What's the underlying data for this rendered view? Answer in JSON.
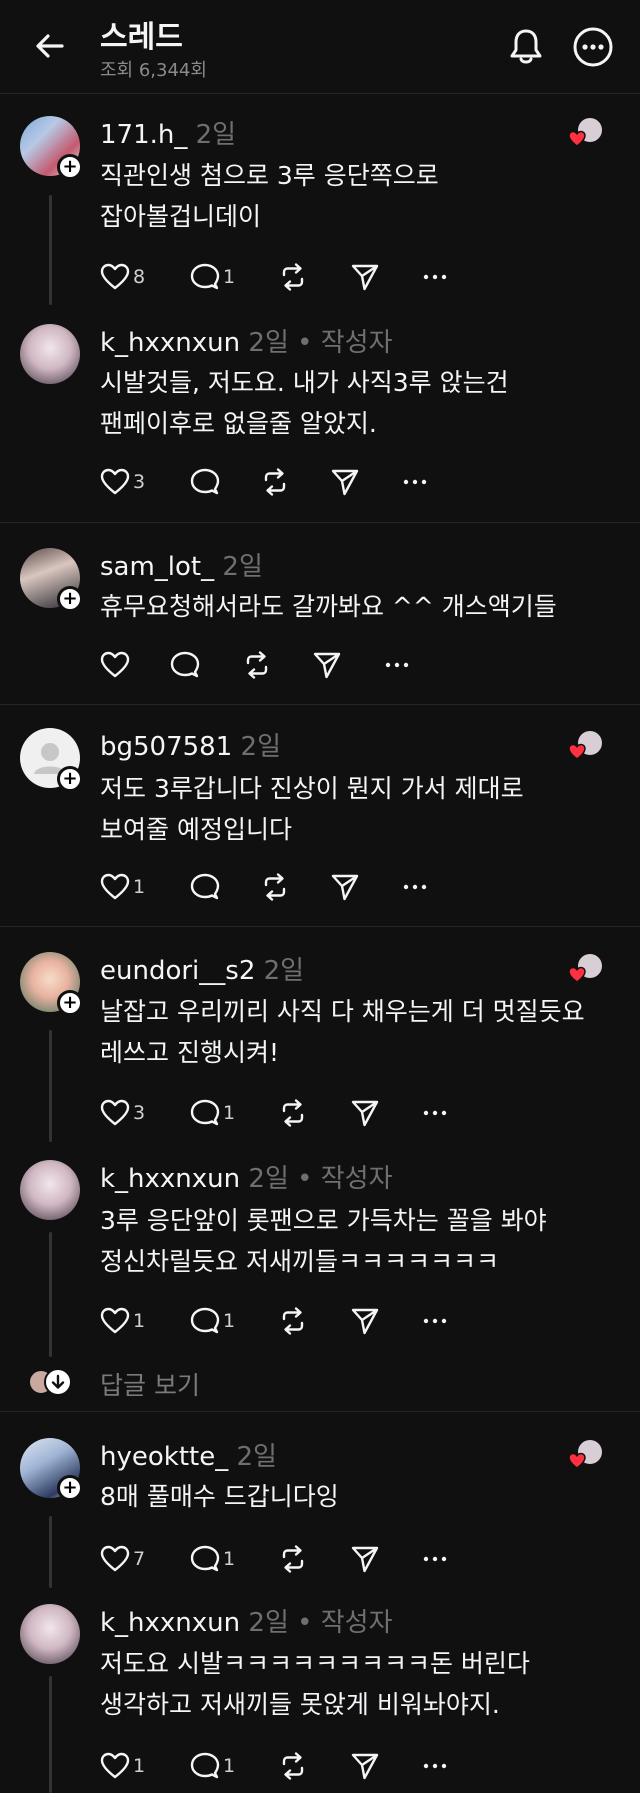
{
  "header": {
    "title": "스레드",
    "views": "조회 6,344회"
  },
  "view_replies_label": "답글 보기",
  "posts": [
    {
      "user": "171.h_",
      "time": "2일",
      "role": "",
      "lines": [
        "직관인생 첨으로 3루 응단쪽으로",
        "잡아볼겁니데이"
      ],
      "likes": "8",
      "replies": "1"
    },
    {
      "user": "k_hxxnxun",
      "time": "2일",
      "role": "• 작성자",
      "lines": [
        "시발것들, 저도요. 내가 사직3루 앉는건",
        "팬페이후로 없을줄 알았지."
      ],
      "likes": "3",
      "replies": ""
    },
    {
      "user": "sam_lot_",
      "time": "2일",
      "role": "",
      "lines": [
        "휴무요청해서라도 갈까봐요 ^^ 개스액기들"
      ],
      "likes": "",
      "replies": ""
    },
    {
      "user": "bg507581",
      "time": "2일",
      "role": "",
      "lines": [
        "저도 3루갑니다 진상이 뭔지 가서 제대로",
        "보여줄 예정입니다"
      ],
      "likes": "1",
      "replies": ""
    },
    {
      "user": "eundori__s2",
      "time": "2일",
      "role": "",
      "lines": [
        "날잡고 우리끼리 사직 다 채우는게 더 멋질듯요",
        "레쓰고 진행시켜!"
      ],
      "likes": "3",
      "replies": "1"
    },
    {
      "user": "k_hxxnxun",
      "time": "2일",
      "role": "• 작성자",
      "lines": [
        "3루 응단앞이 롯팬으로 가득차는 꼴을 봐야",
        "정신차릴듯요  저새끼들ㅋㅋㅋㅋㅋㅋㅋ"
      ],
      "likes": "1",
      "replies": "1"
    },
    {
      "user": "hyeoktte_",
      "time": "2일",
      "role": "",
      "lines": [
        "8매 풀매수 드갑니다잉"
      ],
      "likes": "7",
      "replies": "1"
    },
    {
      "user": "k_hxxnxun",
      "time": "2일",
      "role": "• 작성자",
      "lines": [
        "저도요 시발ㅋㅋㅋㅋㅋㅋㅋㅋㅋ돈 버린다",
        "생각하고 저새끼들 못앉게 비워놔야지."
      ],
      "likes": "1",
      "replies": "1"
    }
  ],
  "colors": {
    "background": "#101010",
    "text": "#f3f5f7",
    "muted": "#6f6f6f",
    "heart": "#ff3040"
  }
}
